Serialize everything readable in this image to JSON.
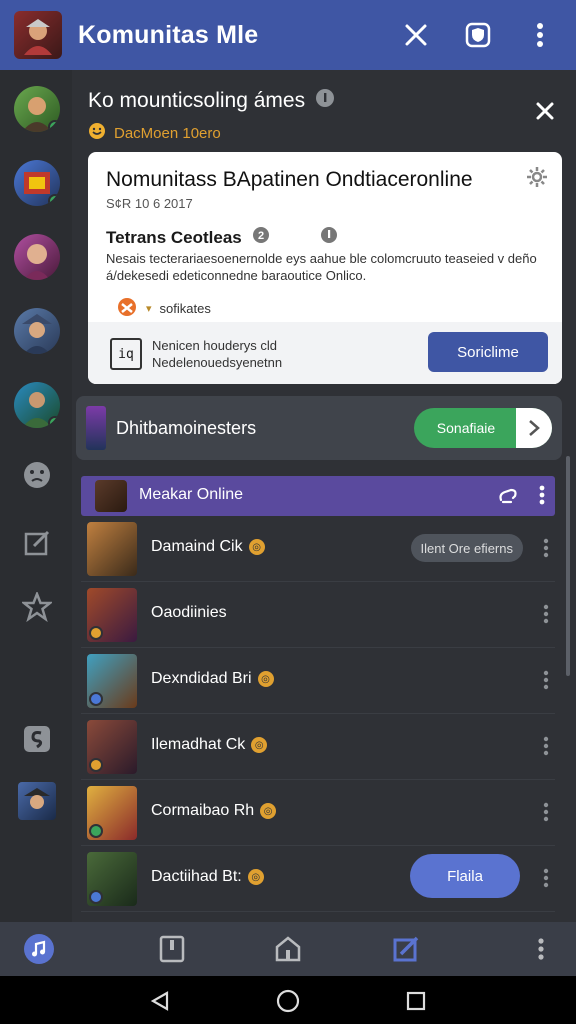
{
  "appbar": {
    "title": "Komunitas Mle"
  },
  "header": {
    "title": "Ko mounticsoling ámes",
    "subtitle": "DacMoen 10ero"
  },
  "card": {
    "title": "Nomunitass BApatinen Ondtiaceronline",
    "meta": "S¢R 10 6 2017",
    "section_title": "Tetrans Ceotleas",
    "description": "Nesais tecterariaesoenernolde eys aahue ble colomcruuto teaseied v deño á/dekesedi edeticonnedne baraoutice Onlico.",
    "tag": "sofikates",
    "footer_icon_text": "iq",
    "footer_text_line1": "Nenicen houderys cld",
    "footer_text_line2": "Nedelenouedsyenetnn",
    "button": "Soriclime"
  },
  "promo": {
    "title": "Dhitbamoinesters",
    "button": "Sonafiaie"
  },
  "selected": {
    "title": "Meakar Online"
  },
  "rows": [
    {
      "name": "Damaind Cik",
      "pill": "Ilent Ore efierns"
    },
    {
      "name": "Oaodiinies",
      "pill": ""
    },
    {
      "name": "Dexndidad Bri",
      "pill": ""
    },
    {
      "name": "Ilemadhat Ck",
      "pill": ""
    },
    {
      "name": "Cormaibao Rh",
      "pill": ""
    },
    {
      "name": "Dactiihad Bt:",
      "pill": ""
    }
  ],
  "fab": {
    "label": "Flaila"
  },
  "colors": {
    "appbar": "#3f56a4",
    "selected": "#5a4a9e",
    "online": "#3ba55c",
    "accent": "#e0a030"
  }
}
